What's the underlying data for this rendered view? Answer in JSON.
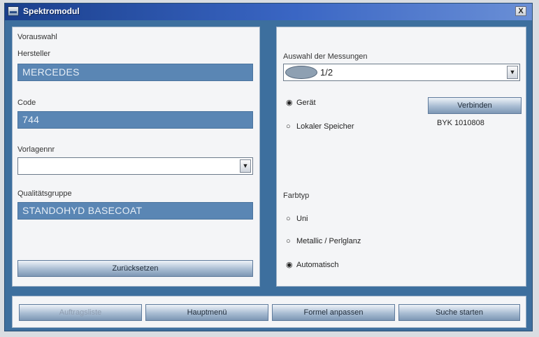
{
  "window": {
    "title": "Spektromodul",
    "close_label": "X"
  },
  "left": {
    "vorauswahl_label": "Vorauswahl",
    "hersteller_label": "Hersteller",
    "hersteller_value": "MERCEDES",
    "code_label": "Code",
    "code_value": "744",
    "vorlagennr_label": "Vorlagennr",
    "vorlagennr_value": "",
    "qualitaet_label": "Qualitätsgruppe",
    "qualitaet_value": "STANDOHYD BASECOAT",
    "reset_button": "Zurücksetzen"
  },
  "right": {
    "messungen_label": "Auswahl der Messungen",
    "messungen_value": "1/2",
    "radio_geraet": "Gerät",
    "radio_lokal": "Lokaler Speicher",
    "connect_button": "Verbinden",
    "device_id": "BYK 1010808",
    "farbtyp_label": "Farbtyp",
    "radio_uni": "Uni",
    "radio_metallic": "Metallic / Perlglanz",
    "radio_auto": "Automatisch",
    "selected_source": "Gerät",
    "selected_farbtyp": "Automatisch"
  },
  "bottom": {
    "btn1": "Auftragsliste",
    "btn2": "Hauptmenü",
    "btn3": "Formel anpassen",
    "btn4": "Suche starten"
  },
  "icons": {
    "radio_on": "◉",
    "radio_off": "○",
    "dropdown": "▼"
  }
}
